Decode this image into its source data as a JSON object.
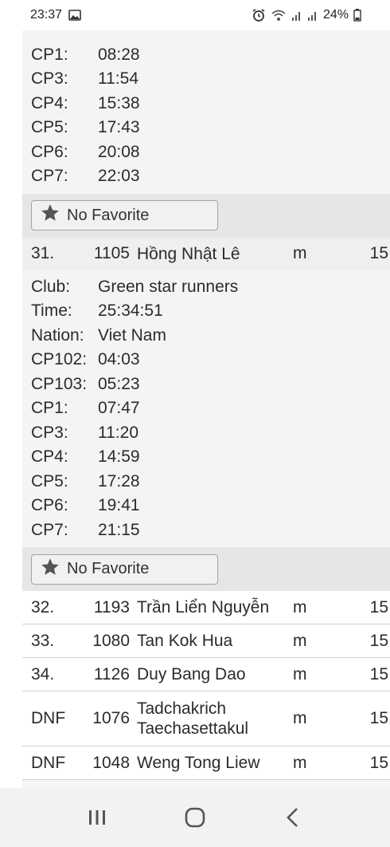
{
  "status_bar": {
    "time": "23:37",
    "battery": "24%",
    "icons": [
      "gallery-icon",
      "alarm-icon",
      "wifi-icon",
      "signal-icon",
      "signal-icon",
      "battery-icon"
    ]
  },
  "prev_runner": {
    "splits": [
      {
        "label": "CP1:",
        "value": "08:28"
      },
      {
        "label": "CP3:",
        "value": "11:54"
      },
      {
        "label": "CP4:",
        "value": "15:38"
      },
      {
        "label": "CP5:",
        "value": "17:43"
      },
      {
        "label": "CP6:",
        "value": "20:08"
      },
      {
        "label": "CP7:",
        "value": "22:03"
      }
    ],
    "favorite_label": "No Favorite"
  },
  "expanded_runner": {
    "place": "31.",
    "bib": "1105",
    "name": "Hồng Nhật Lê",
    "sex": "m",
    "category": "15",
    "details": [
      {
        "label": "Club:",
        "value": "Green star runners"
      },
      {
        "label": "Time:",
        "value": "25:34:51"
      },
      {
        "label": "Nation:",
        "value": "Viet Nam"
      },
      {
        "label": "CP102:",
        "value": "04:03"
      },
      {
        "label": "CP103:",
        "value": "05:23"
      },
      {
        "label": "CP1:",
        "value": "07:47"
      },
      {
        "label": "CP3:",
        "value": "11:20"
      },
      {
        "label": "CP4:",
        "value": "14:59"
      },
      {
        "label": "CP5:",
        "value": "17:28"
      },
      {
        "label": "CP6:",
        "value": "19:41"
      },
      {
        "label": "CP7:",
        "value": "21:15"
      }
    ],
    "favorite_label": "No Favorite"
  },
  "runners": [
    {
      "place": "32.",
      "bib": "1193",
      "name": "Trần Liển Nguyễn",
      "sex": "m",
      "category": "15"
    },
    {
      "place": "33.",
      "bib": "1080",
      "name": "Tan Kok Hua",
      "sex": "m",
      "category": "15"
    },
    {
      "place": "34.",
      "bib": "1126",
      "name": "Duy Bang Dao",
      "sex": "m",
      "category": "15"
    },
    {
      "place": "DNF",
      "bib": "1076",
      "name": "Tadchakrich Taechasettakul",
      "sex": "m",
      "category": "15"
    },
    {
      "place": "DNF",
      "bib": "1048",
      "name": "Weng Tong Liew",
      "sex": "m",
      "category": "15"
    }
  ],
  "nav": {
    "icons": [
      "recent-apps-icon",
      "home-icon",
      "back-icon"
    ]
  }
}
